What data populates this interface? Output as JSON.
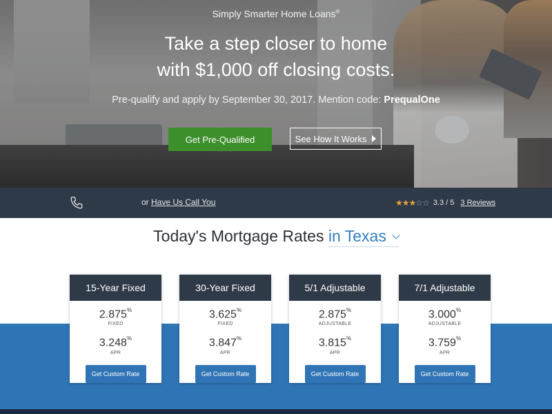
{
  "hero": {
    "tagline": "Simply Smarter Home Loans",
    "tagline_mark": "®",
    "headline_line1": "Take a step closer to home",
    "headline_line2": "with $1,000 off closing costs.",
    "subline_prefix": "Pre-qualify and apply by September 30, 2017. Mention code:",
    "promo_code": "PrequalOne",
    "prequal_button": "Get Pre-Qualified",
    "how_button": "See How It Works"
  },
  "callbar": {
    "phone_icon": "phone-icon",
    "or_text": "or",
    "call_link": "Have Us Call You",
    "rating_value": "3.3 / 5",
    "reviews_link": "3 Reviews",
    "stars_filled": 3.3,
    "stars_total": 5
  },
  "rates": {
    "title": "Today's Mortgage Rates",
    "state": "in Texas",
    "cards": [
      {
        "name": "15-Year Fixed",
        "rate": "2.875",
        "rate_unit": "%",
        "rate_label": "FIXED",
        "apr": "3.248",
        "apr_unit": "%",
        "apr_label": "APR",
        "button": "Get Custom Rate"
      },
      {
        "name": "30-Year Fixed",
        "rate": "3.625",
        "rate_unit": "%",
        "rate_label": "FIXED",
        "apr": "3.847",
        "apr_unit": "%",
        "apr_label": "APR",
        "button": "Get Custom Rate"
      },
      {
        "name": "5/1 Adjustable",
        "rate": "2.875",
        "rate_unit": "%",
        "rate_label": "ADJUSTABLE",
        "apr": "3.815",
        "apr_unit": "%",
        "apr_label": "APR",
        "button": "Get Custom Rate"
      },
      {
        "name": "7/1 Adjustable",
        "rate": "3.000",
        "rate_unit": "%",
        "rate_label": "ADJUSTABLE",
        "apr": "3.759",
        "apr_unit": "%",
        "apr_label": "APR",
        "button": "Get Custom Rate"
      }
    ]
  },
  "colors": {
    "accent_blue": "#2f75b5",
    "navy": "#2f3a48",
    "green_button": "#3c8f2b",
    "star": "#e8a33a"
  }
}
